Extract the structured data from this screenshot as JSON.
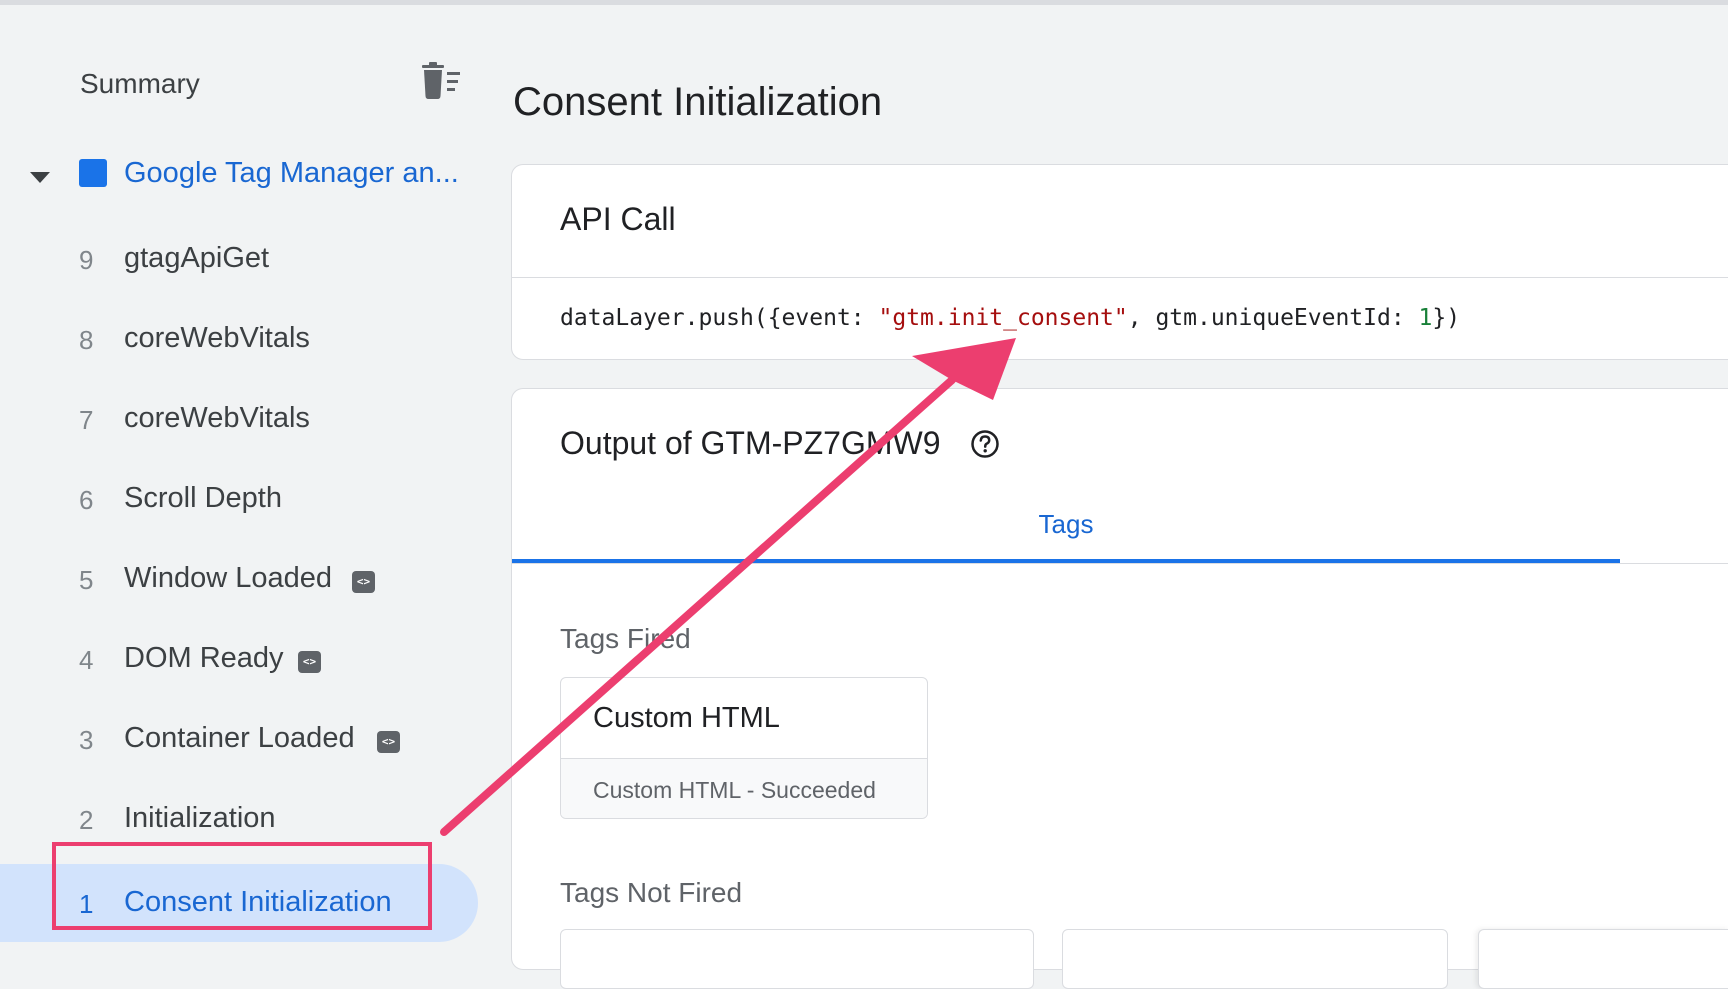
{
  "sidebar": {
    "summary_label": "Summary",
    "container_label": "Google Tag Manager an...",
    "events": [
      {
        "num": "9",
        "name": "gtagApiGet",
        "badge": false,
        "selected": false
      },
      {
        "num": "8",
        "name": "coreWebVitals",
        "badge": false,
        "selected": false
      },
      {
        "num": "7",
        "name": "coreWebVitals",
        "badge": false,
        "selected": false
      },
      {
        "num": "6",
        "name": "Scroll Depth",
        "badge": false,
        "selected": false
      },
      {
        "num": "5",
        "name": "Window Loaded",
        "badge": true,
        "selected": false
      },
      {
        "num": "4",
        "name": "DOM Ready",
        "badge": true,
        "selected": false
      },
      {
        "num": "3",
        "name": "Container Loaded",
        "badge": true,
        "selected": false
      },
      {
        "num": "2",
        "name": "Initialization",
        "badge": false,
        "selected": false
      },
      {
        "num": "1",
        "name": "Consent Initialization",
        "badge": false,
        "selected": true
      }
    ],
    "badge_glyph": "<>"
  },
  "main": {
    "title": "Consent Initialization",
    "api_call": {
      "heading": "API Call",
      "code_prefix": "dataLayer.push({event: ",
      "code_event": "\"gtm.init_consent\"",
      "code_middle": ", gtm.uniqueEventId: ",
      "code_id": "1",
      "code_suffix": "})"
    },
    "output": {
      "heading": "Output of GTM-PZ7GMW9",
      "tab_label": "Tags",
      "tags_fired_label": "Tags Fired",
      "fired_tags": [
        {
          "title": "Custom HTML",
          "status": "Custom HTML - Succeeded"
        }
      ],
      "tags_not_fired_label": "Tags Not Fired"
    }
  },
  "colors": {
    "accent": "#1a73e8",
    "annotation": "#ec3e6f",
    "selected_bg": "#d2e3fc"
  },
  "icons": {
    "summary_action": "trash-list-icon",
    "collapse": "caret-down-icon",
    "help": "help-circle-icon",
    "event_badge": "code-brackets-icon"
  }
}
